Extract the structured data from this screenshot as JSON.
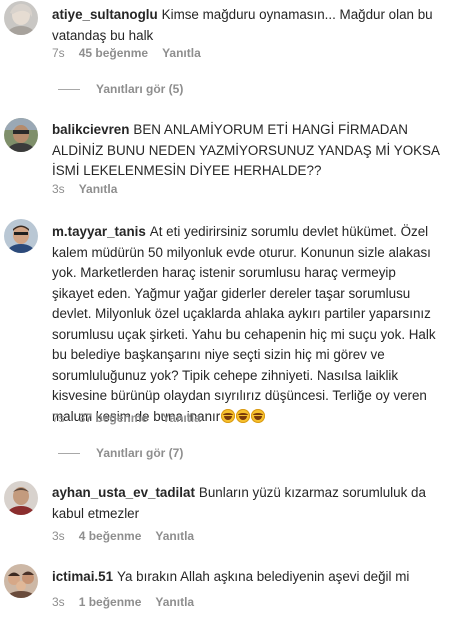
{
  "comments": [
    {
      "username": "atiye_sultanoglu",
      "text": "Kimse mağduru oynamasın... Mağdur olan bu vatandaş bu halk",
      "time": "7s",
      "likes": "45 beğenme",
      "reply": "Yanıtla",
      "view_replies": "Yanıtları gör (5)"
    },
    {
      "username": "balikcievren",
      "text": "BEN ANLAMİYORUM ETİ HANGİ FİRMADAN ALDİNİZ BUNU NEDEN YAZMİYORSUNUZ YANDAŞ Mİ YOKSA İSMİ LEKELENMESİN DİYEE HERHALDE??",
      "time": "3s",
      "reply": "Yanıtla"
    },
    {
      "username": "m.tayyar_tanis",
      "text": "At eti yedirirsiniz sorumlu devlet hükümet. Özel kalem müdürün 50 milyonluk evde oturur. Konunun sizle alakası yok. Marketlerden haraç istenir sorumlusu haraç vermeyip şikayet eden. Yağmur yağar giderler dereler taşar sorumlusu devlet. Milyonluk özel uçaklarda ahlaka aykırı partiler yaparsınız sorumlusu uçak şirketi. Yahu bu cehapenin hiç mi suçu yok. Halk bu belediye başkanşarını niye seçti sizin hiç mi görev ve sorumluluğunuz yok? Tipik cehepe zihniyeti. Nasılsa laiklik kisvesine bürünüp olaydan sıyrılırız düşüncesi. Terliğe oy veren malum kesim de buna inanır",
      "time": "7s",
      "likes": "37 beğenme",
      "reply": "Yanıtla",
      "view_replies": "Yanıtları gör (7)"
    },
    {
      "username": "ayhan_usta_ev_tadilat",
      "text": "Bunların yüzü kızarmaz sorumluluk da kabul etmezler",
      "time": "3s",
      "likes": "4 beğenme",
      "reply": "Yanıtla"
    },
    {
      "username": "ictimai.51",
      "text": "Ya bırakın Allah aşkına belediyenin aşevi değil mi",
      "time": "3s",
      "likes": "1 beğenme",
      "reply": "Yanıtla"
    }
  ],
  "colors": {
    "text": "#262626",
    "secondary": "#8e8e8e",
    "emoji": "#f7c12d"
  },
  "icons": [
    "laughing-tears-emoji"
  ]
}
